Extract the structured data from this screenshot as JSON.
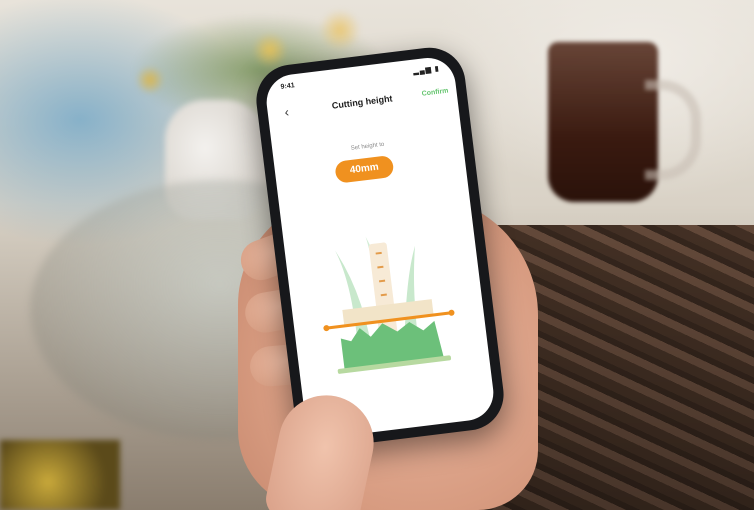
{
  "status": {
    "time": "9:41",
    "icons": "▂▄▆ ▮"
  },
  "header": {
    "back_icon": "‹",
    "title": "Cutting height",
    "confirm_label": "Confirm"
  },
  "main": {
    "set_label": "Set height to",
    "height_value": "40mm"
  },
  "colors": {
    "accent": "#f0911f",
    "grass": "#6cc07a",
    "confirm": "#64c46e"
  }
}
